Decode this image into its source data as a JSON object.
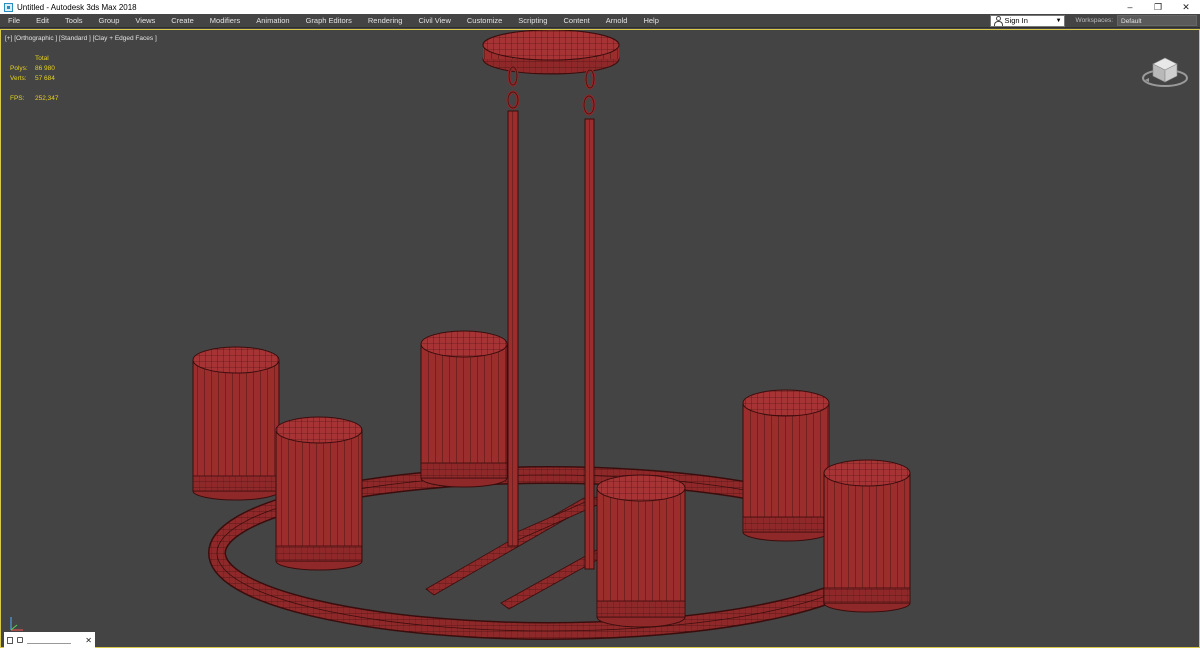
{
  "window": {
    "title": "Untitled - Autodesk 3ds Max 2018",
    "minimize": "–",
    "restore": "❐",
    "close": "✕"
  },
  "menu": {
    "items": [
      "File",
      "Edit",
      "Tools",
      "Group",
      "Views",
      "Create",
      "Modifiers",
      "Animation",
      "Graph Editors",
      "Rendering",
      "Civil View",
      "Customize",
      "Scripting",
      "Content",
      "Arnold",
      "Help"
    ],
    "sign_in": "Sign In",
    "workspaces_label": "Workspaces:",
    "workspace_value": "Default"
  },
  "viewport": {
    "label": "[+] [Orthographic ] [Standard ] [Clay + Edged Faces ]",
    "stats": {
      "header": "Total",
      "polys_label": "Polys:",
      "polys_value": "86 980",
      "verts_label": "Verts:",
      "verts_value": "57 684",
      "fps_label": "FPS:",
      "fps_value": "252,347"
    },
    "model_color": "#9b2d2d",
    "wire_color": "#3a0d0d",
    "frame_color": "#d9c94a"
  },
  "mini_panel": {
    "close": "✕"
  },
  "icons": {
    "viewcube": "viewcube-icon",
    "axis": "axis-tripod-icon",
    "user": "user-icon"
  }
}
